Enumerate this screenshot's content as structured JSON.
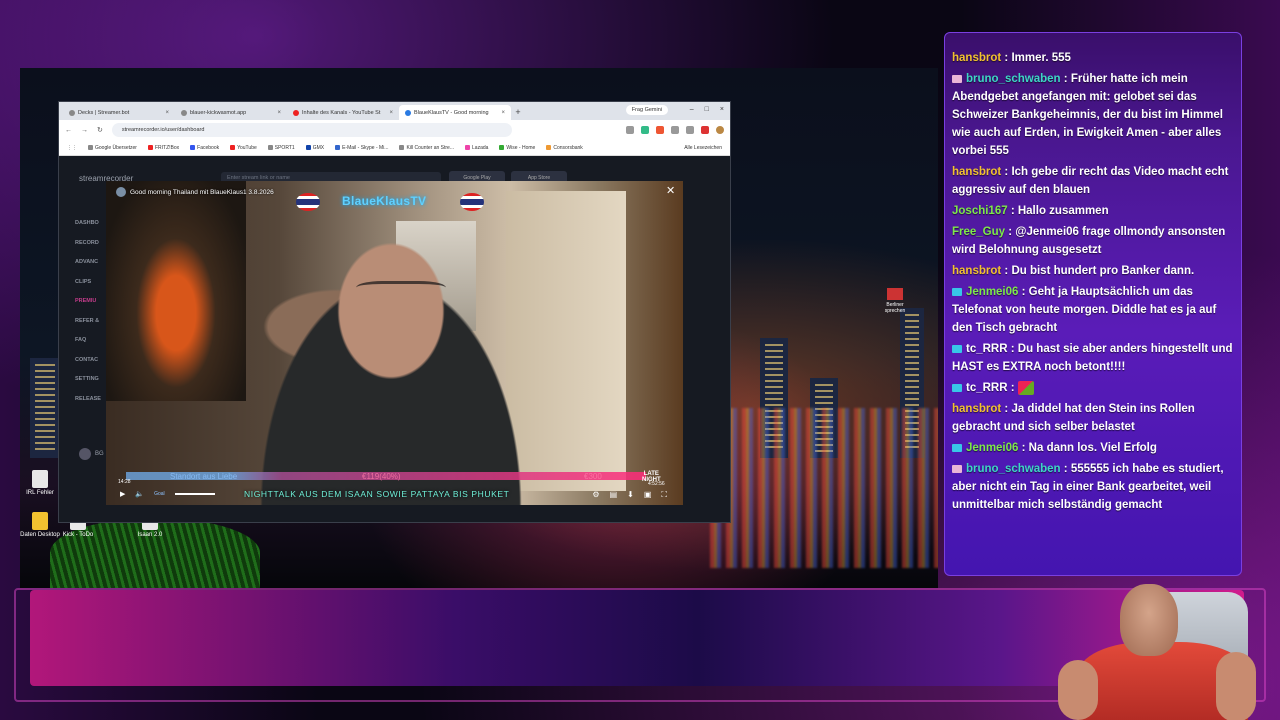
{
  "browser": {
    "tabs": [
      {
        "label": "Decks | Streamer.bot",
        "active": false
      },
      {
        "label": "blauer-kickwasmot.app",
        "active": false
      },
      {
        "label": "Inhalte des Kanals - YouTube St",
        "active": false
      },
      {
        "label": "BlaueKlausTV - Good morning",
        "active": true
      }
    ],
    "gemini_label": "Frag Gemini",
    "url": "streamrecorder.io/user/dashboard",
    "bookmarks": [
      "Google Übersetzer",
      "FRITZ!Box",
      "Facebook",
      "YouTube",
      "SPORT1",
      "GMX",
      "E-Mail - Skype - Mi...",
      "Kill Counter an Stre...",
      "Lazada",
      "Wise - Home",
      "Consorsbank"
    ],
    "all_bookmarks_label": "Alle Lesezeichen"
  },
  "streamrecorder": {
    "logo": "streamrecorder",
    "search_placeholder": "Enter stream link or name",
    "store_buttons": [
      "Google Play",
      "App Store"
    ],
    "nav": [
      "DASHBO",
      "RECORD",
      "ADVANC",
      "CLIPS",
      "PREMIU",
      "REFER &",
      "FAQ",
      "CONTAC",
      "SETTING",
      "RELEASE"
    ],
    "user_label": "BG"
  },
  "video": {
    "title": "Good morning Thailand mit BlaueKlaus1 3.8.2026",
    "channel_name": "BlaueKlausTV",
    "goal_left": "Standort aus Liebe",
    "goal_mid": "€119(40%)",
    "goal_right": "€300",
    "late_badge_top": "LATE",
    "late_badge_bottom": "NIGHT",
    "timecode": "14:28",
    "goal_label": "Goal",
    "ticker": "NIGHTTALK AUS DEM ISAAN SOWIE PATTAYA BIS PHUKET",
    "duration": "4:52:56"
  },
  "desktop_icons": [
    {
      "label": "IRL Fehler",
      "type": "file"
    },
    {
      "label": "Daten Desktop",
      "type": "folder"
    },
    {
      "label": "Kick - ToDo",
      "type": "file"
    },
    {
      "label": "Isaan 2.0",
      "type": "file"
    }
  ],
  "berliner_label": "Berliner sprechen",
  "chat": {
    "messages": [
      {
        "user": "hansbrot",
        "color": "#f2c230",
        "badge": "",
        "text": "Immer. 555"
      },
      {
        "user": "bruno_schwaben",
        "color": "#3dd6c5",
        "badge": "#e9b5d6",
        "text": "Früher hatte ich mein Abendgebet angefangen mit: gelobet sei das Schweizer Bankgeheimnis, der du bist im Himmel wie auch auf Erden, in Ewigkeit Amen - aber alles vorbei 555"
      },
      {
        "user": "hansbrot",
        "color": "#f2c230",
        "badge": "",
        "text": "Ich gebe dir recht das Video macht echt aggressiv auf den blauen"
      },
      {
        "user": "Joschi167",
        "color": "#7ee84a",
        "badge": "",
        "text": "Hallo zusammen"
      },
      {
        "user": "Free_Guy",
        "color": "#7ee84a",
        "badge": "",
        "text": "@Jenmei06 frage ollmondy ansonsten wird Belohnung ausgesetzt"
      },
      {
        "user": "hansbrot",
        "color": "#f2c230",
        "badge": "",
        "text": "Du bist hundert pro Banker dann."
      },
      {
        "user": "Jenmei06",
        "color": "#7ee84a",
        "badge": "#38c6e8",
        "text": "Geht ja Hauptsächlich um das Telefonat von heute morgen. Diddle hat es ja auf den Tisch gebracht"
      },
      {
        "user": "tc_RRR",
        "color": "#ffffff",
        "badge": "#38c6e8",
        "text": "Du hast sie aber anders hingestellt und HAST es EXTRA noch betont!!!!"
      },
      {
        "user": "tc_RRR",
        "color": "#ffffff",
        "badge": "#38c6e8",
        "text": ""
      },
      {
        "user": "hansbrot",
        "color": "#f2c230",
        "badge": "",
        "text": "Ja diddel hat den Stein ins Rollen gebracht und sich selber belastet"
      },
      {
        "user": "Jenmei06",
        "color": "#7ee84a",
        "badge": "#38c6e8",
        "text": "Na dann los. Viel Erfolg"
      },
      {
        "user": "bruno_schwaben",
        "color": "#3dd6c5",
        "badge": "#e9b5d6",
        "text": "555555 ich habe es studiert, aber nicht ein Tag in einer Bank gearbeitet, weil unmittelbar mich selbständig gemacht"
      }
    ]
  }
}
